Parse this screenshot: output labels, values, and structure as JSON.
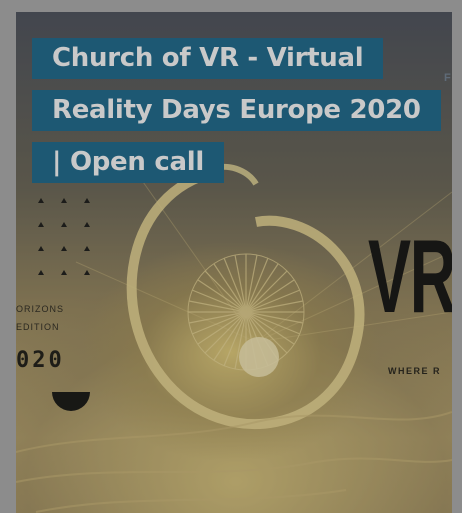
{
  "card": {
    "title": "Church of VR - Virtual Reality Days Europe 2020 | Open call"
  },
  "poster": {
    "corner_letter": "F",
    "horizons_line1": "ORIZONS",
    "horizons_line2": "EDITION",
    "year": "020",
    "logo_text": "VR",
    "tagline": "WHERE R"
  },
  "colors": {
    "title_bg": "#1d5873",
    "title_text": "#c9c9c9",
    "page_bg": "#8c8c8c"
  }
}
